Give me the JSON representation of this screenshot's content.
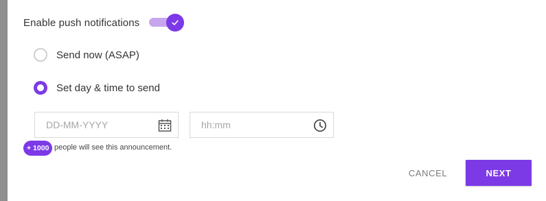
{
  "push": {
    "label": "Enable push notifications",
    "enabled": true
  },
  "schedule": {
    "options": [
      {
        "label": "Send now (ASAP)",
        "selected": false
      },
      {
        "label": "Set day & time to send",
        "selected": true
      }
    ]
  },
  "date_field": {
    "placeholder": "DD-MM-YYYY",
    "value": "",
    "icon": "calendar-icon"
  },
  "time_field": {
    "placeholder": "hh:mm",
    "value": "",
    "icon": "clock-icon"
  },
  "reach": {
    "badge": "+ 1000",
    "text": "people will see this announcement."
  },
  "actions": {
    "cancel_label": "CANCEL",
    "next_label": "NEXT"
  },
  "colors": {
    "accent": "#7c3ae6",
    "accent_light": "#c8a6ee",
    "backdrop": "#8f8f8f"
  }
}
